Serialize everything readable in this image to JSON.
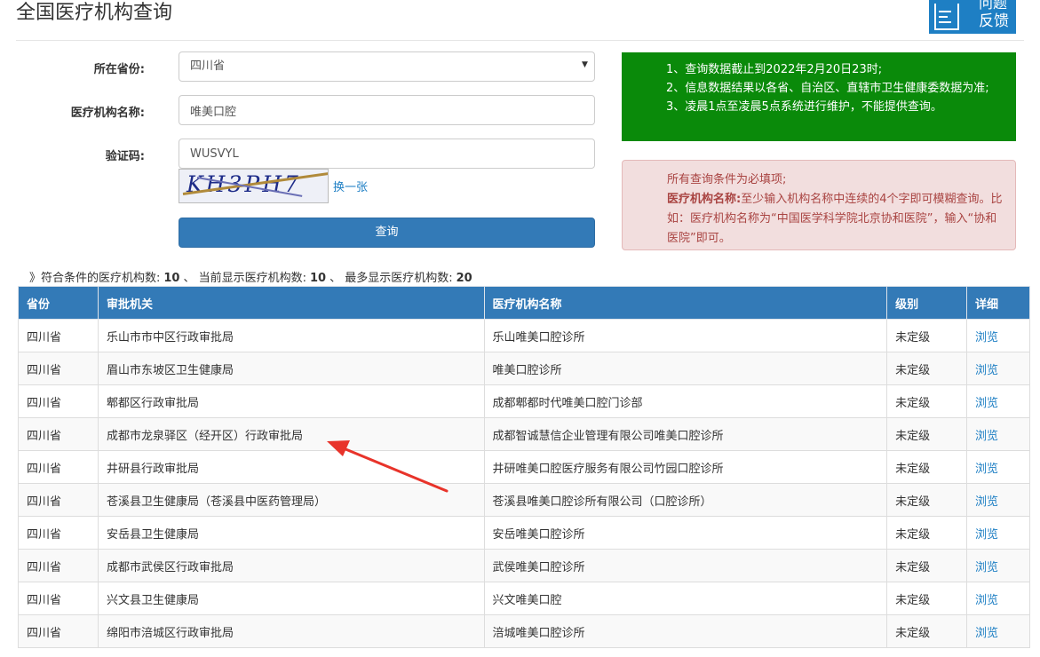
{
  "page": {
    "title": "全国医疗机构查询",
    "feedback": {
      "line1": "问题",
      "line2": "反馈"
    }
  },
  "form": {
    "province_label": "所在省份:",
    "province_value": "四川省",
    "institution_label": "医疗机构名称:",
    "institution_value": "唯美口腔",
    "captcha_label": "验证码:",
    "captcha_value": "WUSVYL",
    "captcha_image_text": "KH3PH7",
    "refresh_label": "换一张",
    "query_button": "查询"
  },
  "notice_green": {
    "lines": [
      "1、查询数据截止到2022年2月20日23时;",
      "2、信息数据结果以各省、自治区、直辖市卫生健康委数据为准;",
      "3、凌晨1点至凌晨5点系统进行维护，不能提供查询。"
    ]
  },
  "notice_red": {
    "line1": "所有查询条件为必填项;",
    "bold_label": "医疗机构名称:",
    "line2": "至少输入机构名称中连续的4个字即可模糊查询。比如：医疗机构名称为“中国医学科学院北京协和医院”，输入“协和医院”即可。"
  },
  "summary": {
    "prefix": "》符合条件的医疗机构数:",
    "match_count": "10",
    "sep1": "、 当前显示医疗机构数:",
    "shown_count": "10",
    "sep2": "、 最多显示医疗机构数:",
    "max_count": "20"
  },
  "table": {
    "headers": [
      "省份",
      "审批机关",
      "医疗机构名称",
      "级别",
      "详细"
    ],
    "rows": [
      [
        "四川省",
        "乐山市市中区行政审批局",
        "乐山唯美口腔诊所",
        "未定级",
        "浏览"
      ],
      [
        "四川省",
        "眉山市东坡区卫生健康局",
        "唯美口腔诊所",
        "未定级",
        "浏览"
      ],
      [
        "四川省",
        "郫都区行政审批局",
        "成都郫都时代唯美口腔门诊部",
        "未定级",
        "浏览"
      ],
      [
        "四川省",
        "成都市龙泉驿区（经开区）行政审批局",
        "成都智诚慧信企业管理有限公司唯美口腔诊所",
        "未定级",
        "浏览"
      ],
      [
        "四川省",
        "井研县行政审批局",
        "井研唯美口腔医疗服务有限公司竹园口腔诊所",
        "未定级",
        "浏览"
      ],
      [
        "四川省",
        "苍溪县卫生健康局（苍溪县中医药管理局）",
        "苍溪县唯美口腔诊所有限公司（口腔诊所）",
        "未定级",
        "浏览"
      ],
      [
        "四川省",
        "安岳县卫生健康局",
        "安岳唯美口腔诊所",
        "未定级",
        "浏览"
      ],
      [
        "四川省",
        "成都市武侯区行政审批局",
        "武侯唯美口腔诊所",
        "未定级",
        "浏览"
      ],
      [
        "四川省",
        "兴文县卫生健康局",
        "兴文唯美口腔",
        "未定级",
        "浏览"
      ],
      [
        "四川省",
        "绵阳市涪城区行政审批局",
        "涪城唯美口腔诊所",
        "未定级",
        "浏览"
      ]
    ]
  },
  "colors": {
    "primary": "#337ab7",
    "notice_green": "#0a8a0a",
    "notice_red_bg": "#f2dede",
    "notice_red_text": "#a94442",
    "annotation_arrow": "#e8332a"
  }
}
